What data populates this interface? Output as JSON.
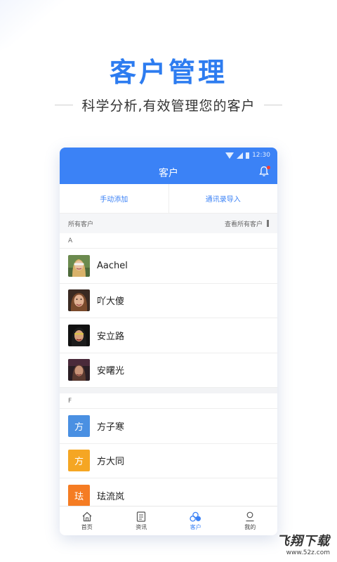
{
  "promo": {
    "title": "客户管理",
    "subtitle": "科学分析,有效管理您的客户"
  },
  "status_bar": {
    "time": "12:30"
  },
  "header": {
    "title": "客户"
  },
  "actions": {
    "manual_add": "手动添加",
    "import_contacts": "通讯录导入"
  },
  "section": {
    "all_customers": "所有客户",
    "view_all": "查看所有客户"
  },
  "groups": [
    {
      "letter": "A",
      "contacts": [
        {
          "name": "Aachel",
          "avatar": "photo"
        },
        {
          "name": "吖大傻",
          "avatar": "photo"
        },
        {
          "name": "安立路",
          "avatar": "photo"
        },
        {
          "name": "安曙光",
          "avatar": "photo"
        }
      ]
    },
    {
      "letter": "F",
      "contacts": [
        {
          "name": "方子寒",
          "avatar_text": "方",
          "avatar_color": "#4a90e2"
        },
        {
          "name": "方大同",
          "avatar_text": "方",
          "avatar_color": "#f5a623"
        },
        {
          "name": "珐流岚",
          "avatar_text": "珐",
          "avatar_color": "#f57c23"
        }
      ]
    }
  ],
  "tabs": [
    {
      "label": "首页",
      "icon": "home-icon"
    },
    {
      "label": "资讯",
      "icon": "news-icon"
    },
    {
      "label": "客户",
      "icon": "customers-icon",
      "active": true
    },
    {
      "label": "我的",
      "icon": "profile-icon"
    }
  ],
  "colors": {
    "accent": "#3b82f6",
    "title": "#2d7cf0",
    "notification": "#ff3b30"
  },
  "watermark": {
    "main": "飞翔下载",
    "url": "www.52z.com"
  }
}
